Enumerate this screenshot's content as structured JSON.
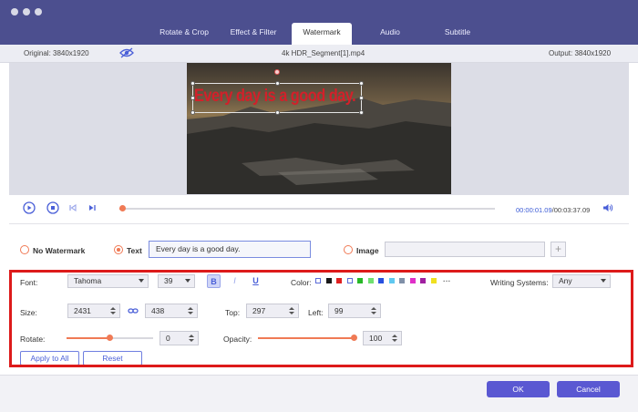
{
  "tabs": [
    "Rotate & Crop",
    "Effect & Filter",
    "Watermark",
    "Audio",
    "Subtitle"
  ],
  "active_tab": "Watermark",
  "info": {
    "original": "Original: 3840x1920",
    "filename": "4k HDR_Segment[1].mp4",
    "output": "Output: 3840x1920"
  },
  "preview": {
    "watermark_text": "Every day is a good day."
  },
  "playback": {
    "current_time": "00:00:01.09",
    "total_time": "/00:03:37.09",
    "progress": 0.005
  },
  "watermark_mode": {
    "no_watermark": "No Watermark",
    "text": "Text",
    "text_value": "Every day is a good day.",
    "image": "Image",
    "selected": "Text",
    "add_icon": "+"
  },
  "style": {
    "font_label": "Font:",
    "font": "Tahoma",
    "font_size": "39",
    "bold": "B",
    "italic": "I",
    "underline": "U",
    "color_label": "Color:",
    "colors": [
      "#ffffff",
      "#1a1a1a",
      "#e02020",
      "#ffffff",
      "#28b828",
      "#70e070",
      "#2850e0",
      "#60c8f0",
      "#8090a8",
      "#e030c8",
      "#a020a0",
      "#f0e020"
    ],
    "more": "···",
    "writing_label": "Writing Systems:",
    "writing_value": "Any"
  },
  "position": {
    "size_label": "Size:",
    "width": "2431",
    "height": "438",
    "top_label": "Top:",
    "top": "297",
    "left_label": "Left:",
    "left": "99"
  },
  "adjust": {
    "rotate_label": "Rotate:",
    "rotate": "0",
    "rotate_level": 0.5,
    "opacity_label": "Opacity:",
    "opacity": "100",
    "opacity_level": 1.0
  },
  "actions": {
    "apply_all": "Apply to All",
    "reset": "Reset"
  },
  "footer": {
    "ok": "OK",
    "cancel": "Cancel"
  },
  "accent": "#4a5fd8",
  "highlight": "#dd1a1a"
}
